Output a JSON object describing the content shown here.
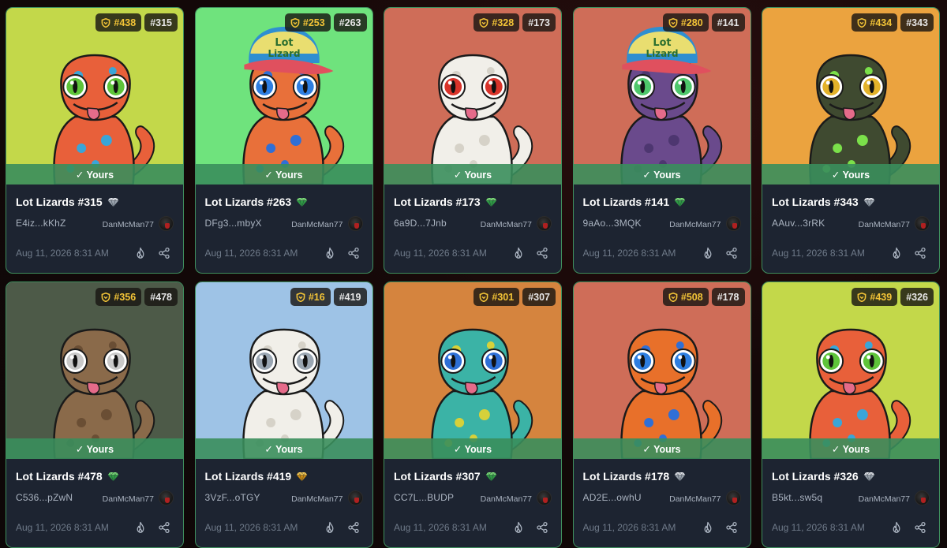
{
  "yours_label": "✓ Yours",
  "cards": [
    {
      "rank": "#438",
      "num": "#315",
      "title": "Lot Lizards #315",
      "gem": "silver",
      "addr": "E4iz...kKhZ",
      "owner": "DanMcMan77",
      "date": "Aug 11, 2026 8:31 AM",
      "bg": "#c3d84a",
      "lizard": "#e8603a",
      "spot": "#3aa5d8",
      "eye": "#5ec43a",
      "hat": false
    },
    {
      "rank": "#253",
      "num": "#263",
      "title": "Lot Lizards #263",
      "gem": "green",
      "addr": "DFg3...mbyX",
      "owner": "DanMcMan77",
      "date": "Aug 11, 2026 8:31 AM",
      "bg": "#6fe37d",
      "lizard": "#e8703a",
      "spot": "#2f6fd6",
      "eye": "#2e7ee0",
      "hat": true
    },
    {
      "rank": "#328",
      "num": "#173",
      "title": "Lot Lizards #173",
      "gem": "green",
      "addr": "6a9D...7Jnb",
      "owner": "DanMcMan77",
      "date": "Aug 11, 2026 8:31 AM",
      "bg": "#cf6d58",
      "lizard": "#f1efe9",
      "spot": "#d6d2c8",
      "eye": "#d8332a",
      "hat": false
    },
    {
      "rank": "#280",
      "num": "#141",
      "title": "Lot Lizards #141",
      "gem": "green",
      "addr": "9aAo...3MQK",
      "owner": "DanMcMan77",
      "date": "Aug 11, 2026 8:31 AM",
      "bg": "#cf6d58",
      "lizard": "#6a4a8c",
      "spot": "#4d3670",
      "eye": "#4ec76b",
      "hat": true
    },
    {
      "rank": "#434",
      "num": "#343",
      "title": "Lot Lizards #343",
      "gem": "silver",
      "addr": "AAuv...3rRK",
      "owner": "DanMcMan77",
      "date": "Aug 11, 2026 8:31 AM",
      "bg": "#eba33f",
      "lizard": "#3f4a30",
      "spot": "#7be04a",
      "eye": "#e3b22a",
      "hat": false
    },
    {
      "rank": "#356",
      "num": "#478",
      "title": "Lot Lizards #478",
      "gem": "green",
      "addr": "C536...pZwN",
      "owner": "DanMcMan77",
      "date": "Aug 11, 2026 8:31 AM",
      "bg": "#4d5a48",
      "lizard": "#8a6a4a",
      "spot": "#6a4e34",
      "eye": "#c9c9c9",
      "hat": false
    },
    {
      "rank": "#16",
      "num": "#419",
      "title": "Lot Lizards #419",
      "gem": "gold",
      "addr": "3VzF...oTGY",
      "owner": "DanMcMan77",
      "date": "Aug 11, 2026 8:31 AM",
      "bg": "#9ec3e6",
      "lizard": "#f1efe9",
      "spot": "#d6d2c8",
      "eye": "#9aa6b2",
      "hat": false
    },
    {
      "rank": "#301",
      "num": "#307",
      "title": "Lot Lizards #307",
      "gem": "green",
      "addr": "CC7L...BUDP",
      "owner": "DanMcMan77",
      "date": "Aug 11, 2026 8:31 AM",
      "bg": "#d5843e",
      "lizard": "#3bb3a6",
      "spot": "#d6d13a",
      "eye": "#2e6fd6",
      "hat": false
    },
    {
      "rank": "#508",
      "num": "#178",
      "title": "Lot Lizards #178",
      "gem": "silver",
      "addr": "AD2E...owhU",
      "owner": "DanMcMan77",
      "date": "Aug 11, 2026 8:31 AM",
      "bg": "#cf6d58",
      "lizard": "#e8702a",
      "spot": "#2f6fd6",
      "eye": "#2e7ee0",
      "hat": false
    },
    {
      "rank": "#439",
      "num": "#326",
      "title": "Lot Lizards #326",
      "gem": "silver",
      "addr": "B5kt...sw5q",
      "owner": "DanMcMan77",
      "date": "Aug 11, 2026 8:31 AM",
      "bg": "#c3d84a",
      "lizard": "#e8603a",
      "spot": "#3aa5d8",
      "eye": "#5ec43a",
      "hat": false
    }
  ]
}
